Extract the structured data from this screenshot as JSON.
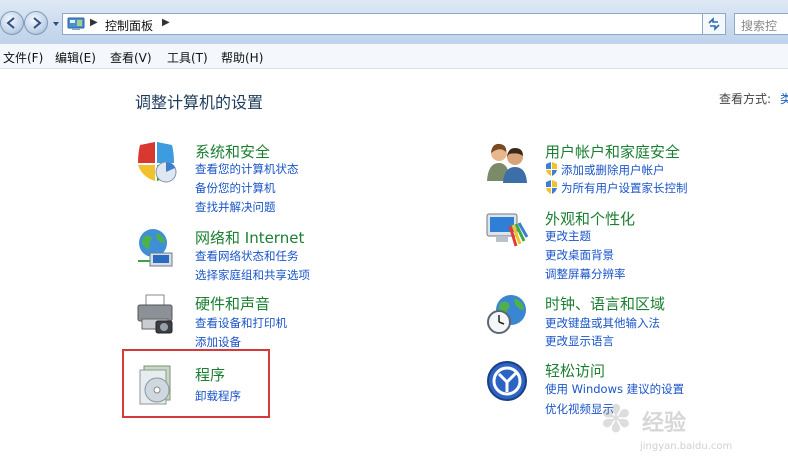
{
  "address_bar": {
    "breadcrumb": "控制面板",
    "search_placeholder": "搜索控"
  },
  "menu": {
    "items": [
      "文件(F)",
      "编辑(E)",
      "查看(V)",
      "工具(T)",
      "帮助(H)"
    ]
  },
  "main": {
    "title": "调整计算机的设置",
    "view_by_label": "查看方式:",
    "view_by_value": "类"
  },
  "categories": {
    "system_security": {
      "title": "系统和安全",
      "icon": "shield-icon",
      "links": [
        "查看您的计算机状态",
        "备份您的计算机",
        "查找并解决问题"
      ]
    },
    "network": {
      "title": "网络和 Internet",
      "icon": "network-globe-icon",
      "links": [
        "查看网络状态和任务",
        "选择家庭组和共享选项"
      ]
    },
    "hardware": {
      "title": "硬件和声音",
      "icon": "printer-icon",
      "links": [
        "查看设备和打印机",
        "添加设备"
      ]
    },
    "programs": {
      "title": "程序",
      "icon": "programs-disc-icon",
      "links": [
        "卸载程序"
      ]
    },
    "user_accounts": {
      "title": "用户帐户和家庭安全",
      "icon": "users-icon",
      "links": [
        "添加或删除用户帐户",
        "为所有用户设置家长控制"
      ]
    },
    "appearance": {
      "title": "外观和个性化",
      "icon": "appearance-monitor-icon",
      "links": [
        "更改主题",
        "更改桌面背景",
        "调整屏幕分辨率"
      ]
    },
    "clock_region": {
      "title": "时钟、语言和区域",
      "icon": "clock-globe-icon",
      "links": [
        "更改键盘或其他输入法",
        "更改显示语言"
      ]
    },
    "ease_access": {
      "title": "轻松访问",
      "icon": "ease-of-access-icon",
      "links": [
        "使用 Windows 建议的设置",
        "优化视频显示"
      ]
    }
  },
  "watermark": {
    "name": "经验",
    "url": "jingyan.baidu.com"
  },
  "colors": {
    "category_title": "#1b7f32",
    "link": "#1a55c8",
    "highlight_box": "#d6393c"
  }
}
